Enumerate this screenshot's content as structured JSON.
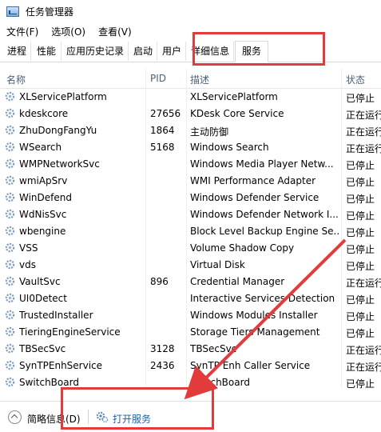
{
  "window": {
    "title": "任务管理器"
  },
  "menu": [
    "文件(F)",
    "选项(O)",
    "查看(V)"
  ],
  "tabs": [
    {
      "label": "进程"
    },
    {
      "label": "性能"
    },
    {
      "label": "应用历史记录"
    },
    {
      "label": "启动"
    },
    {
      "label": "用户"
    },
    {
      "label": "详细信息"
    },
    {
      "label": "服务",
      "active": true
    }
  ],
  "columns": {
    "name": "名称",
    "pid": "PID",
    "desc": "描述",
    "status": "状态"
  },
  "services": [
    {
      "name": "XLServicePlatform",
      "pid": "",
      "desc": "XLServicePlatform",
      "status": "已停止"
    },
    {
      "name": "kdeskcore",
      "pid": "27656",
      "desc": "KDesk Core Service",
      "status": "正在运行"
    },
    {
      "name": "ZhuDongFangYu",
      "pid": "1864",
      "desc": "主动防御",
      "status": "正在运行"
    },
    {
      "name": "WSearch",
      "pid": "5168",
      "desc": "Windows Search",
      "status": "正在运行"
    },
    {
      "name": "WMPNetworkSvc",
      "pid": "",
      "desc": "Windows Media Player Netw...",
      "status": "已停止"
    },
    {
      "name": "wmiApSrv",
      "pid": "",
      "desc": "WMI Performance Adapter",
      "status": "已停止"
    },
    {
      "name": "WinDefend",
      "pid": "",
      "desc": "Windows Defender Service",
      "status": "已停止"
    },
    {
      "name": "WdNisSvc",
      "pid": "",
      "desc": "Windows Defender Network I...",
      "status": "已停止"
    },
    {
      "name": "wbengine",
      "pid": "",
      "desc": "Block Level Backup Engine Se...",
      "status": "已停止"
    },
    {
      "name": "VSS",
      "pid": "",
      "desc": "Volume Shadow Copy",
      "status": "已停止"
    },
    {
      "name": "vds",
      "pid": "",
      "desc": "Virtual Disk",
      "status": "已停止"
    },
    {
      "name": "VaultSvc",
      "pid": "896",
      "desc": "Credential Manager",
      "status": "正在运行"
    },
    {
      "name": "UI0Detect",
      "pid": "",
      "desc": "Interactive Services Detection",
      "status": "已停止"
    },
    {
      "name": "TrustedInstaller",
      "pid": "",
      "desc": "Windows Modules Installer",
      "status": "已停止"
    },
    {
      "name": "TieringEngineService",
      "pid": "",
      "desc": "Storage Tiers Management",
      "status": "已停止"
    },
    {
      "name": "TBSecSvc",
      "pid": "3128",
      "desc": "TBSecSvc",
      "status": "正在运行"
    },
    {
      "name": "SynTPEnhService",
      "pid": "2436",
      "desc": "SynTP Enh Caller Service",
      "status": "正在运行"
    },
    {
      "name": "SwitchBoard",
      "pid": "",
      "desc": "SwitchBoard",
      "status": "已停止"
    }
  ],
  "footer": {
    "brief": "简略信息(D)",
    "open_services": "打开服务"
  },
  "colors": {
    "annotation_red": "#e23b3b",
    "link_blue": "#1a5fb4"
  }
}
